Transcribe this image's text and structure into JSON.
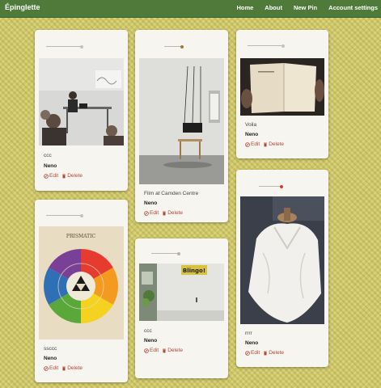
{
  "navbar": {
    "brand": "Épinglette",
    "links": [
      "Home",
      "About",
      "New Pin",
      "Account settings"
    ]
  },
  "pins": [
    {
      "caption": "ccc",
      "author": "Neno",
      "edit": "Edit",
      "delete": "Delete"
    },
    {
      "caption": "Film at Camden Centre",
      "author": "Neno",
      "edit": "Edit",
      "delete": "Delete"
    },
    {
      "caption": "Voila",
      "author": "Neno",
      "edit": "Edit",
      "delete": "Delete"
    },
    {
      "caption": "ssccc",
      "author": "Neno",
      "edit": "Edit",
      "delete": "Delete"
    },
    {
      "caption": "ccc",
      "author": "Neno",
      "edit": "Edit",
      "delete": "Delete"
    },
    {
      "caption": "rrrr",
      "author": "Neno",
      "edit": "Edit",
      "delete": "Delete"
    }
  ],
  "image_texts": {
    "color_wheel_title": "PRISMATIC",
    "shop_sign": "Blingo!"
  },
  "colors": {
    "navbar": "#4f7a3a",
    "action": "#b0453a",
    "card": "#f7f5ef"
  }
}
